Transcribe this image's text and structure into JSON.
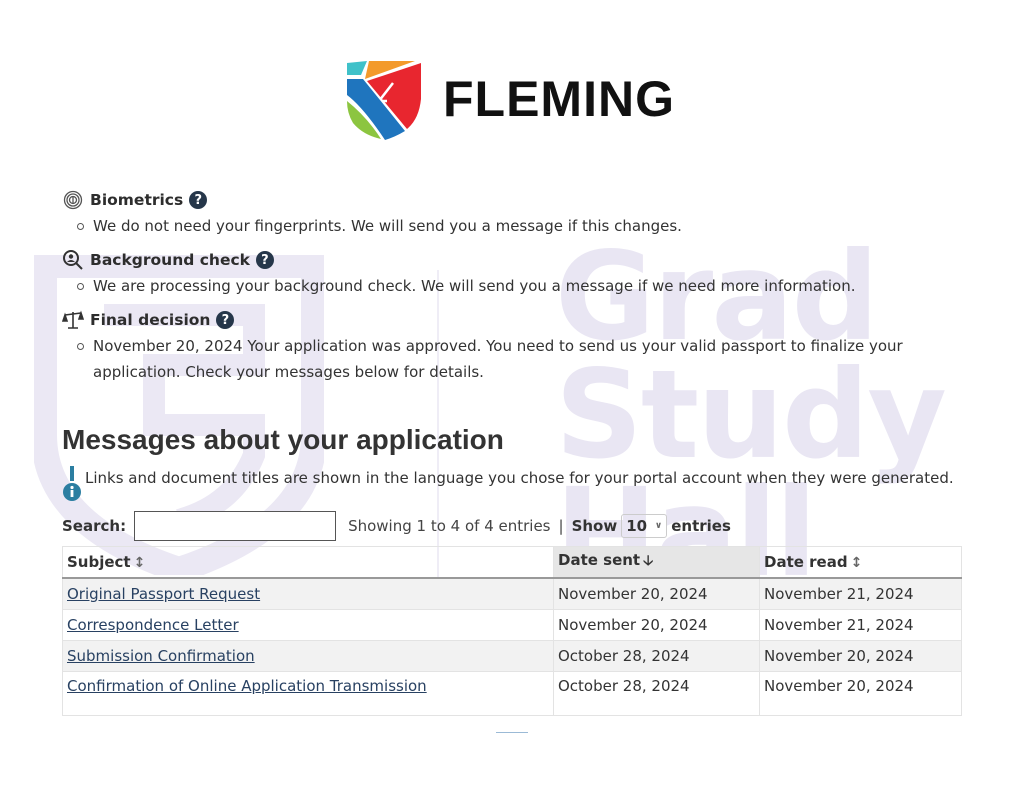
{
  "watermark": {
    "lines": [
      "Grad",
      "Study",
      "Hall"
    ]
  },
  "logo": {
    "name": "FLEMING",
    "colors": {
      "teal": "#3fc1c9",
      "orange": "#f39a2b",
      "red": "#e8262f",
      "blue": "#1f75be",
      "green": "#8cc540"
    }
  },
  "status": {
    "items": [
      {
        "icon": "fingerprint-icon",
        "title": "Biometrics",
        "text": "We do not need your fingerprints. We will send you a message if this changes."
      },
      {
        "icon": "search-person-icon",
        "title": "Background check",
        "text": "We are processing your background check. We will send you a message if we need more information."
      },
      {
        "icon": "scale-icon",
        "title": "Final decision",
        "text": "November 20, 2024 Your application was approved. You need to send us your valid passport to finalize your application. Check your messages below for details."
      }
    ]
  },
  "messages": {
    "title": "Messages about your application",
    "note": "Links and document titles are shown in the language you chose for your portal account when they were generated.",
    "search_label": "Search:",
    "search_value": "",
    "showing": "Showing 1 to 4 of 4 entries",
    "separator": "|",
    "show_label": "Show",
    "page_size": "10",
    "entries_label": "entries",
    "columns": [
      "Subject",
      "Date sent",
      "Date read"
    ],
    "sort_state": [
      "unsorted",
      "descending",
      "unsorted"
    ],
    "rows": [
      {
        "subject": "Original Passport Request",
        "date_sent": "November 20, 2024",
        "date_read": "November 21, 2024"
      },
      {
        "subject": "Correspondence Letter",
        "date_sent": "November 20, 2024",
        "date_read": "November 21, 2024"
      },
      {
        "subject": "Submission Confirmation",
        "date_sent": "October 28, 2024",
        "date_read": "November 20, 2024"
      },
      {
        "subject": "Confirmation of Online Application Transmission",
        "date_sent": "October 28, 2024",
        "date_read": "November 20, 2024"
      }
    ]
  },
  "colors": {
    "link": "#284162",
    "help_badge": "#26374a",
    "info_icon": "#2b7ea1",
    "watermark": "#e9e6f3"
  }
}
